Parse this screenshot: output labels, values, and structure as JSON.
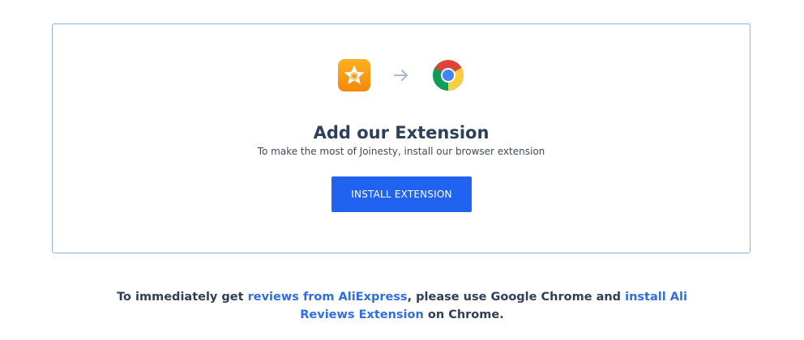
{
  "card": {
    "icons": {
      "app_icon": "star-coin-icon",
      "arrow_icon": "arrow-right-icon",
      "browser_icon": "chrome-icon"
    },
    "title": "Add our Extension",
    "subtitle": "To make the most of Joinesty, install our browser extension",
    "install_button": "INSTALL EXTENSION"
  },
  "footer": {
    "text_1": "To immediately get ",
    "link_1": "reviews from AliExpress",
    "text_2": ", please use Google Chrome and ",
    "link_2": "install Ali Reviews Extension",
    "text_3": " on Chrome."
  },
  "colors": {
    "accent": "#1f63f0",
    "link": "#2f6ee8",
    "border": "#8fb3de",
    "text": "#2e3f5b",
    "app_icon": "#f79a12"
  }
}
